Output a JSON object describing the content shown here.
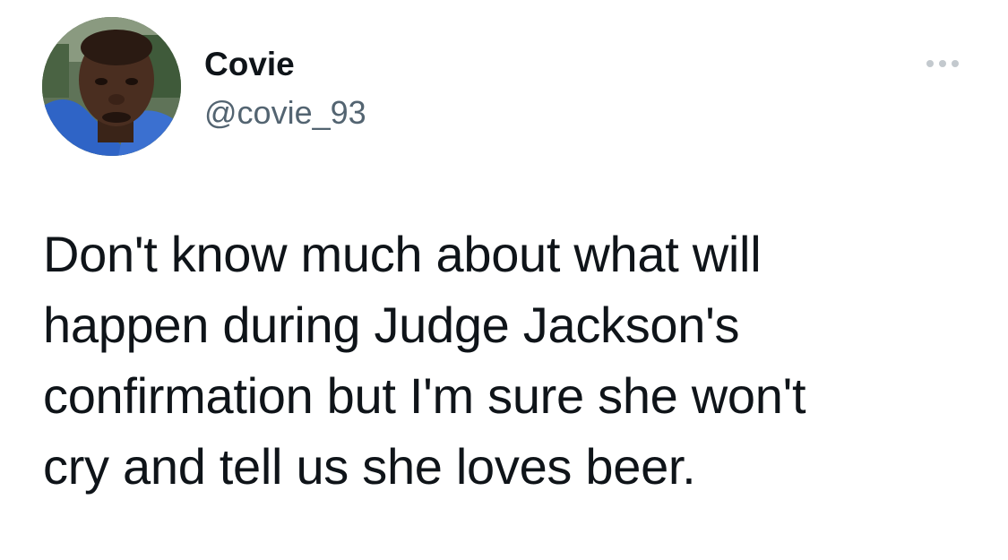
{
  "tweet": {
    "author": {
      "display_name": "Covie",
      "handle": "@covie_93"
    },
    "text": "Don't know much about what will\nhappen during Judge Jackson's\nconfirmation but I'm sure she won't\ncry and tell us she loves beer.",
    "more_icon": "more-horizontal-icon"
  },
  "colors": {
    "text_primary": "#0f1419",
    "text_secondary": "#536471",
    "background": "#ffffff"
  }
}
